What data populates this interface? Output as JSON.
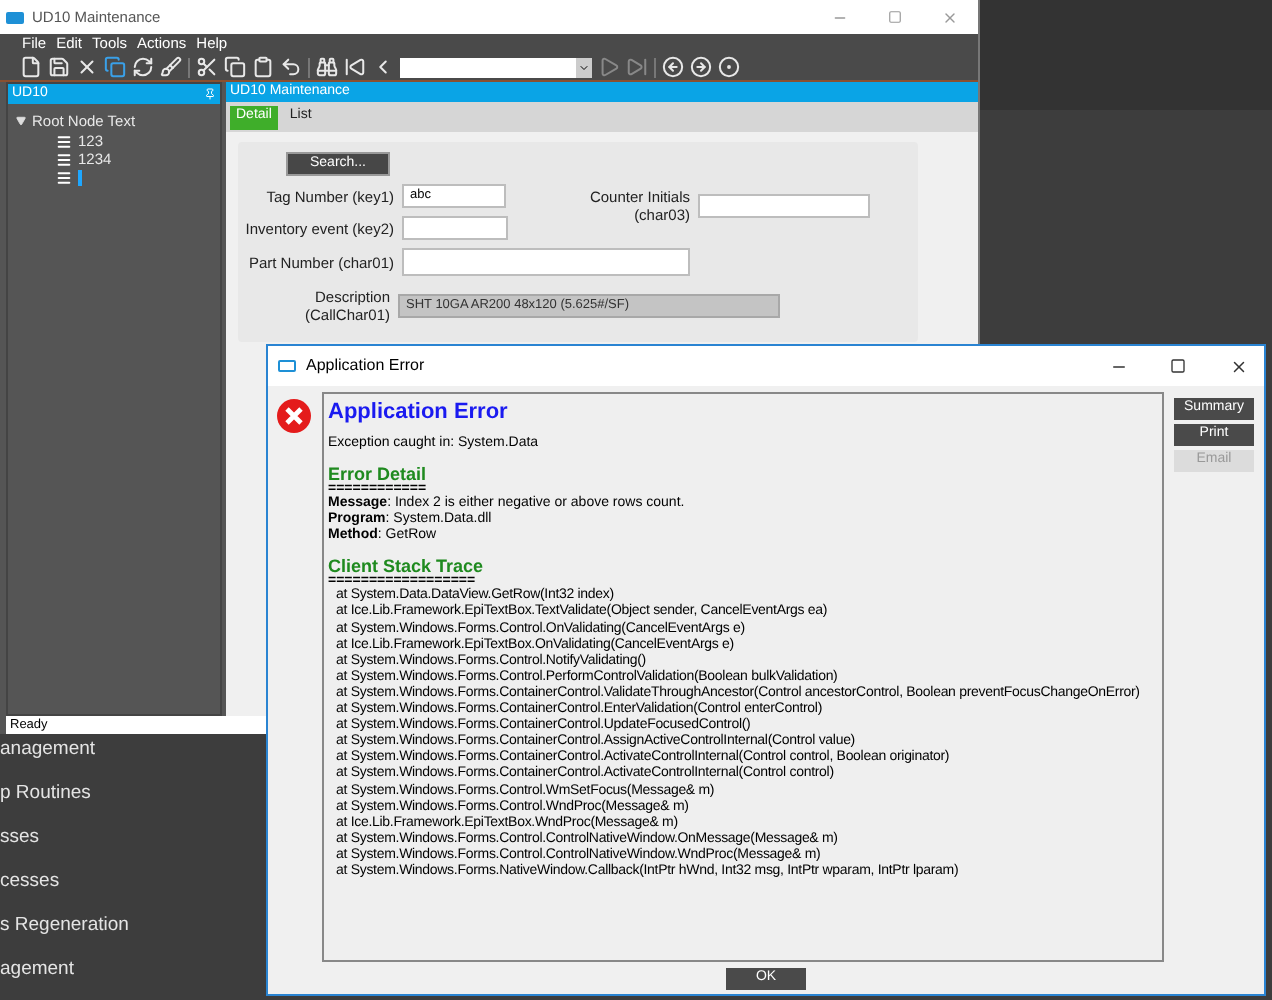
{
  "background_menu": [
    "anagement",
    "p Routines",
    "sses",
    "cesses",
    "s Regeneration",
    "agement"
  ],
  "main_window": {
    "title": "UD10 Maintenance",
    "menu": [
      "File",
      "Edit",
      "Tools",
      "Actions",
      "Help"
    ],
    "tree_panel": {
      "title": "UD10",
      "root": {
        "label": "Root Node Text",
        "expanded": true,
        "children": [
          {
            "label": "123",
            "editing": false
          },
          {
            "label": "1234",
            "editing": false
          },
          {
            "editing": true
          }
        ]
      }
    },
    "panel_title": "UD10 Maintenance",
    "tabs": [
      {
        "label": "Detail",
        "selected": true
      },
      {
        "label": "List",
        "selected": false
      }
    ],
    "search_button": "Search...",
    "fields": [
      {
        "label": "Tag Number (key1)",
        "value": "abc",
        "disabled": false
      },
      {
        "label": "Inventory event (key2)",
        "disabled": false
      },
      {
        "label": "Counter Initials (char03)",
        "disabled": false
      },
      {
        "label": "Part Number (char01)",
        "disabled": false
      },
      {
        "label": "Description (CallChar01)",
        "value": "SHT 10GA AR200 48x120 (5.625#/SF)",
        "disabled": true
      }
    ],
    "status": "Ready"
  },
  "dialog": {
    "title": "Application Error",
    "heading": "Application Error",
    "exception": "Exception caught in: System.Data",
    "detail_heading": "Error Detail",
    "detail_rule": "============",
    "details": [
      "**Message**: Index 2 is either negative or above rows count.",
      "**Program**: System.Data.dll",
      "**Method**: GetRow"
    ],
    "trace_heading": "Client Stack Trace",
    "trace_rule": "==================",
    "trace": [
      "at System.Data.DataView.GetRow(Int32 index)",
      "at Ice.Lib.Framework.EpiTextBox.TextValidate(Object sender, CancelEventArgs ea)",
      "at System.Windows.Forms.Control.OnValidating(CancelEventArgs e)",
      "at Ice.Lib.Framework.EpiTextBox.OnValidating(CancelEventArgs e)",
      "at System.Windows.Forms.Control.NotifyValidating()",
      "at System.Windows.Forms.Control.PerformControlValidation(Boolean bulkValidation)",
      "at System.Windows.Forms.ContainerControl.ValidateThroughAncestor(Control ancestorControl, Boolean preventFocusChangeOnError)",
      "at System.Windows.Forms.ContainerControl.EnterValidation(Control enterControl)",
      "at System.Windows.Forms.ContainerControl.UpdateFocusedControl()",
      "at System.Windows.Forms.ContainerControl.AssignActiveControlInternal(Control value)",
      "at System.Windows.Forms.ContainerControl.ActivateControlInternal(Control control, Boolean originator)",
      "at System.Windows.Forms.ContainerControl.ActivateControlInternal(Control control)",
      "at System.Windows.Forms.Control.WmSetFocus(Message& m)",
      "at System.Windows.Forms.Control.WndProc(Message& m)",
      "at Ice.Lib.Framework.EpiTextBox.WndProc(Message& m)",
      "at System.Windows.Forms.Control.ControlNativeWindow.OnMessage(Message& m)",
      "at System.Windows.Forms.Control.ControlNativeWindow.WndProc(Message& m)",
      "at System.Windows.Forms.NativeWindow.Callback(IntPtr hWnd, Int32 msg, IntPtr wparam, IntPtr lparam)"
    ],
    "buttons": [
      {
        "label": "Summary",
        "disabled": false
      },
      {
        "label": "Print",
        "disabled": false
      },
      {
        "label": "Email",
        "disabled": true
      }
    ],
    "ok_button": "OK"
  }
}
